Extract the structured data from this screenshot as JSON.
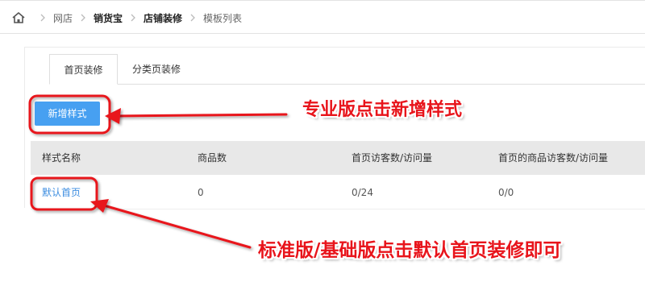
{
  "breadcrumb": {
    "home_icon": "home-icon",
    "items": [
      "网店",
      "销货宝",
      "店铺装修",
      "模板列表"
    ]
  },
  "tabs": [
    {
      "label": "首页装修",
      "active": true
    },
    {
      "label": "分类页装修",
      "active": false
    }
  ],
  "add_button": {
    "label": "新增样式"
  },
  "table": {
    "headers": [
      "样式名称",
      "商品数",
      "首页访客数/访问量",
      "首页的商品访客数/访问量"
    ],
    "rows": [
      [
        "默认首页",
        "0",
        "0/24",
        "0/0"
      ]
    ]
  },
  "annotations": {
    "top_note": "专业版点击新增样式",
    "bottom_note": "标准版/基础版点击默认首页装修即可",
    "color": "#e8141b"
  },
  "colors": {
    "accent": "#47a0f1",
    "link": "#3c8de0",
    "header_bg": "#e8e8e8"
  }
}
